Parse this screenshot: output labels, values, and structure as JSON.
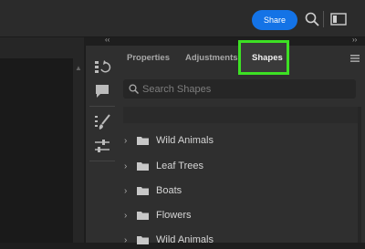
{
  "header": {
    "share_label": "Share"
  },
  "panel": {
    "tabs": [
      {
        "label": "Properties"
      },
      {
        "label": "Adjustments"
      },
      {
        "label": "Shapes",
        "active": true
      }
    ],
    "search": {
      "placeholder": "Search Shapes"
    },
    "shape_groups": [
      {
        "label": "Wild Animals"
      },
      {
        "label": "Leaf Trees"
      },
      {
        "label": "Boats"
      },
      {
        "label": "Flowers"
      },
      {
        "label": "Wild Animals"
      }
    ]
  },
  "colors": {
    "accent": "#1473e6",
    "highlight": "#3de024"
  }
}
